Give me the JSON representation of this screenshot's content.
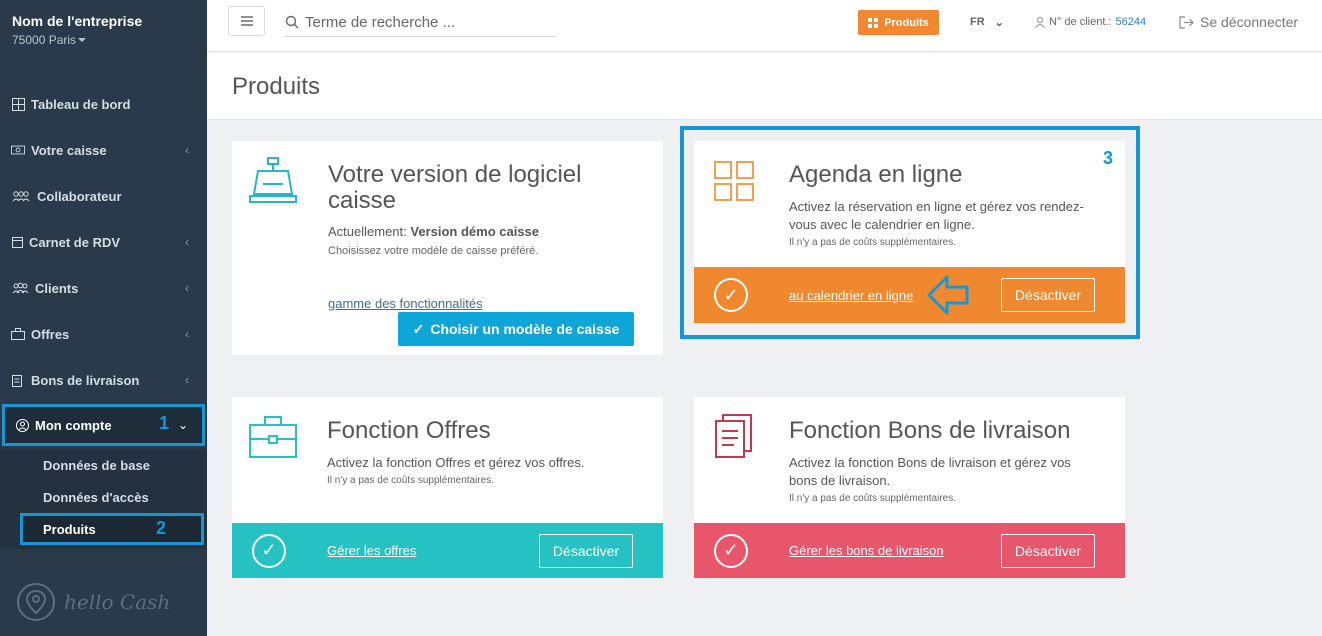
{
  "sidebar": {
    "company_name": "Nom de l'entreprise",
    "company_city": "75000 Paris",
    "items": [
      {
        "label": "Tableau de bord",
        "icon": "dashboard-icon"
      },
      {
        "label": "Votre caisse",
        "icon": "cash-register-icon"
      },
      {
        "label": "Collaborateur",
        "icon": "staff-icon"
      },
      {
        "label": "Carnet de RDV",
        "icon": "calendar-icon"
      },
      {
        "label": "Clients",
        "icon": "clients-icon"
      },
      {
        "label": "Offres",
        "icon": "briefcase-icon"
      },
      {
        "label": "Bons de livraison",
        "icon": "clipboard-icon"
      },
      {
        "label": "Mon compte",
        "icon": "account-icon"
      }
    ],
    "account_marker": "1",
    "subitems": [
      {
        "label": "Données de base"
      },
      {
        "label": "Données d'accès"
      },
      {
        "label": "Produits"
      }
    ],
    "produits_marker": "2",
    "logo_text": "hello Cash"
  },
  "topbar": {
    "search_placeholder": "Terme de recherche ...",
    "produits_label": "Produits",
    "lang": "FR",
    "client_label": "N° de client.:",
    "client_number": "56244",
    "logout_label": "Se déconnecter"
  },
  "page": {
    "title": "Produits"
  },
  "cards": {
    "caisse": {
      "title": "Votre version de logiciel caisse",
      "current_prefix": "Actuellement:",
      "current_value": "Version démo caisse",
      "desc": "Choisissez votre modèle de caisse préféré.",
      "link": "gamme des fonctionnalités",
      "button": "Choisir un modèle de caisse"
    },
    "agenda": {
      "title": "Agenda en ligne",
      "desc": "Activez la réservation en ligne et gérez vos rendez-vous avec le calendrier en ligne.",
      "note": "Il n'y a pas de coûts supplémentaires.",
      "link": "au calendrier en ligne",
      "button": "Désactiver",
      "marker": "3",
      "color": "#f0882f"
    },
    "offres": {
      "title": "Fonction Offres",
      "desc": "Activez la fonction Offres et gérez vos offres.",
      "note": "Il n'y a pas de coûts supplémentaires.",
      "link": "Gérer les offres",
      "button": "Désactiver",
      "color": "#26c2c3"
    },
    "livraison": {
      "title": "Fonction Bons de livraison",
      "desc": "Activez la fonction Bons de livraison et gérez vos bons de livraison.",
      "note": "Il n'y a pas de coûts supplémentaires.",
      "link": "Gérer les bons de livraison",
      "button": "Désactiver",
      "color": "#e8566b"
    }
  },
  "colors": {
    "sidebar_bg": "#2b3a4a",
    "highlight": "#1796d6",
    "accent_orange": "#f0882f"
  }
}
